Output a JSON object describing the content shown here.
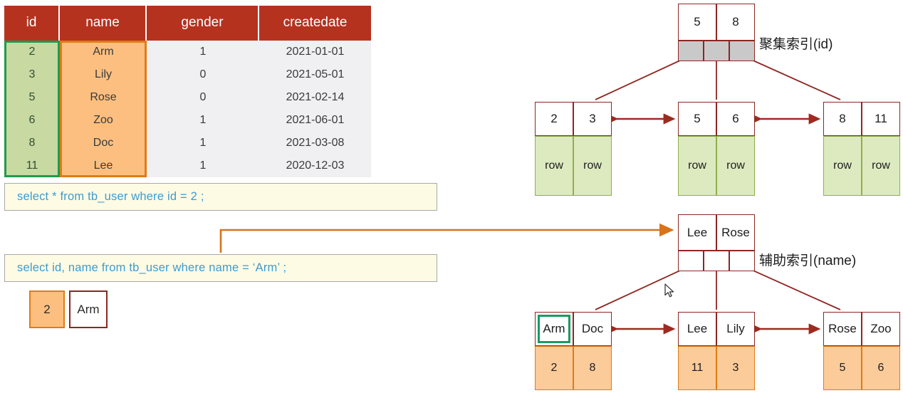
{
  "table": {
    "columns": [
      "id",
      "name",
      "gender",
      "createdate"
    ],
    "rows": [
      {
        "id": "2",
        "name": "Arm",
        "gender": "1",
        "createdate": "2021-01-01"
      },
      {
        "id": "3",
        "name": "Lily",
        "gender": "0",
        "createdate": "2021-05-01"
      },
      {
        "id": "5",
        "name": "Rose",
        "gender": "0",
        "createdate": "2021-02-14"
      },
      {
        "id": "6",
        "name": "Zoo",
        "gender": "1",
        "createdate": "2021-06-01"
      },
      {
        "id": "8",
        "name": "Doc",
        "gender": "1",
        "createdate": "2021-03-08"
      },
      {
        "id": "11",
        "name": "Lee",
        "gender": "1",
        "createdate": "2020-12-03"
      }
    ],
    "highlight_id_color": "#1f9c4d",
    "highlight_name_color": "#e07b16",
    "header_color": "#b5321f"
  },
  "queries": {
    "query1": "select * from  tb_user  where  id  =  2 ;",
    "query2": "select  id, name  from  tb_user  where  name = ‘Arm’ ;"
  },
  "result": {
    "id": "2",
    "name": "Arm"
  },
  "clustered_index": {
    "label": "聚集索引(id)",
    "root": {
      "keys": [
        "5",
        "8"
      ],
      "pointers": [
        "",
        "",
        ""
      ]
    },
    "leaves": [
      {
        "keys": [
          "2",
          "3"
        ],
        "data": [
          "row",
          "row"
        ]
      },
      {
        "keys": [
          "5",
          "6"
        ],
        "data": [
          "row",
          "row"
        ]
      },
      {
        "keys": [
          "8",
          "11"
        ],
        "data": [
          "row",
          "row"
        ]
      }
    ]
  },
  "secondary_index": {
    "label": "辅助索引(name)",
    "root": {
      "keys": [
        "Lee",
        "Rose"
      ],
      "pointers": [
        "",
        "",
        ""
      ]
    },
    "leaves": [
      {
        "keys": [
          "Arm",
          "Doc"
        ],
        "data": [
          "2",
          "8"
        ],
        "highlight_key": 0
      },
      {
        "keys": [
          "Lee",
          "Lily"
        ],
        "data": [
          "11",
          "3"
        ],
        "highlight_key": -1
      },
      {
        "keys": [
          "Rose",
          "Zoo"
        ],
        "data": [
          "5",
          "6"
        ],
        "highlight_key": -1
      }
    ]
  }
}
